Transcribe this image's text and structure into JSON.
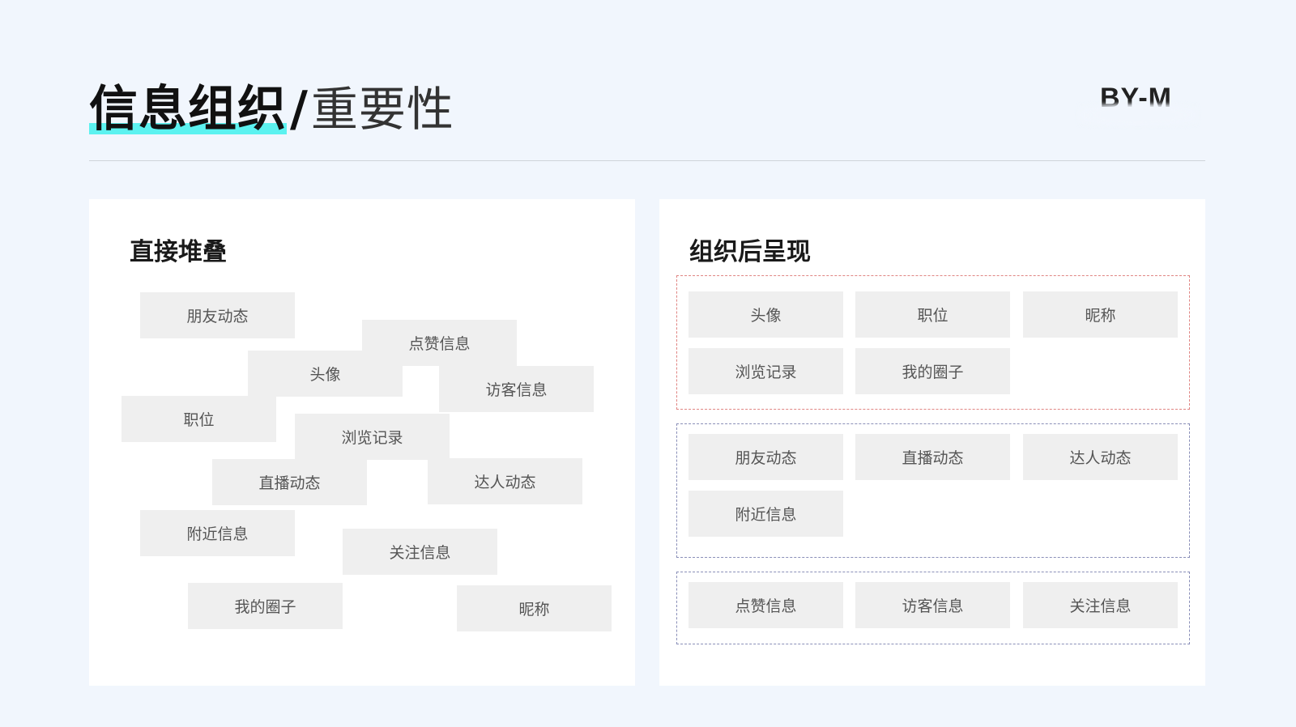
{
  "header": {
    "title_main": "信息组织",
    "title_sep": "/",
    "title_sub": "重要性",
    "brand": "BY-M"
  },
  "left_panel": {
    "title": "直接堆叠",
    "tags": [
      "朋友动态",
      "点赞信息",
      "头像",
      "访客信息",
      "职位",
      "浏览记录",
      "直播动态",
      "达人动态",
      "附近信息",
      "关注信息",
      "我的圈子",
      "昵称"
    ]
  },
  "right_panel": {
    "title": "组织后呈现",
    "groups": [
      {
        "tags": [
          "头像",
          "职位",
          "昵称",
          "浏览记录",
          "我的圈子"
        ]
      },
      {
        "tags": [
          "朋友动态",
          "直播动态",
          "达人动态",
          "附近信息"
        ]
      },
      {
        "tags": [
          "点赞信息",
          "访客信息",
          "关注信息"
        ]
      }
    ]
  },
  "colors": {
    "background": "#f1f6fd",
    "highlight": "#5cf2f0",
    "tag_bg": "#efefef",
    "group1_border": "#e08583",
    "group2_border": "#8a8fb8"
  }
}
